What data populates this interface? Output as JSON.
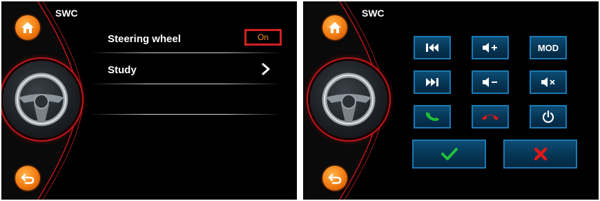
{
  "left": {
    "title": "SWC",
    "menu": [
      {
        "label": "Steering wheel",
        "value": "On"
      },
      {
        "label": "Study"
      }
    ],
    "icons": {
      "home": "home-icon",
      "back": "back-arrow-icon",
      "wheel": "steering-wheel-icon"
    }
  },
  "right": {
    "title": "SWC",
    "keys": [
      {
        "name": "previous-track",
        "icon": "skip-back-icon"
      },
      {
        "name": "volume-up",
        "icon": "volume-up-icon"
      },
      {
        "name": "mode",
        "label": "MOD"
      },
      {
        "name": "next-track",
        "icon": "skip-forward-icon"
      },
      {
        "name": "volume-down",
        "icon": "volume-down-icon"
      },
      {
        "name": "mute",
        "icon": "mute-icon"
      },
      {
        "name": "answer-call",
        "icon": "phone-answer-icon"
      },
      {
        "name": "hang-up",
        "icon": "phone-hangup-icon"
      },
      {
        "name": "power",
        "icon": "power-icon"
      }
    ],
    "confirm": {
      "icon": "checkmark-icon"
    },
    "cancel": {
      "icon": "close-x-icon"
    }
  },
  "colors": {
    "accent": "#f27a10",
    "badge_border": "#d42020",
    "key_fill": "#063553",
    "key_border": "#1a7ab4",
    "confirm": "#1fbf3a",
    "cancel": "#e01818"
  }
}
